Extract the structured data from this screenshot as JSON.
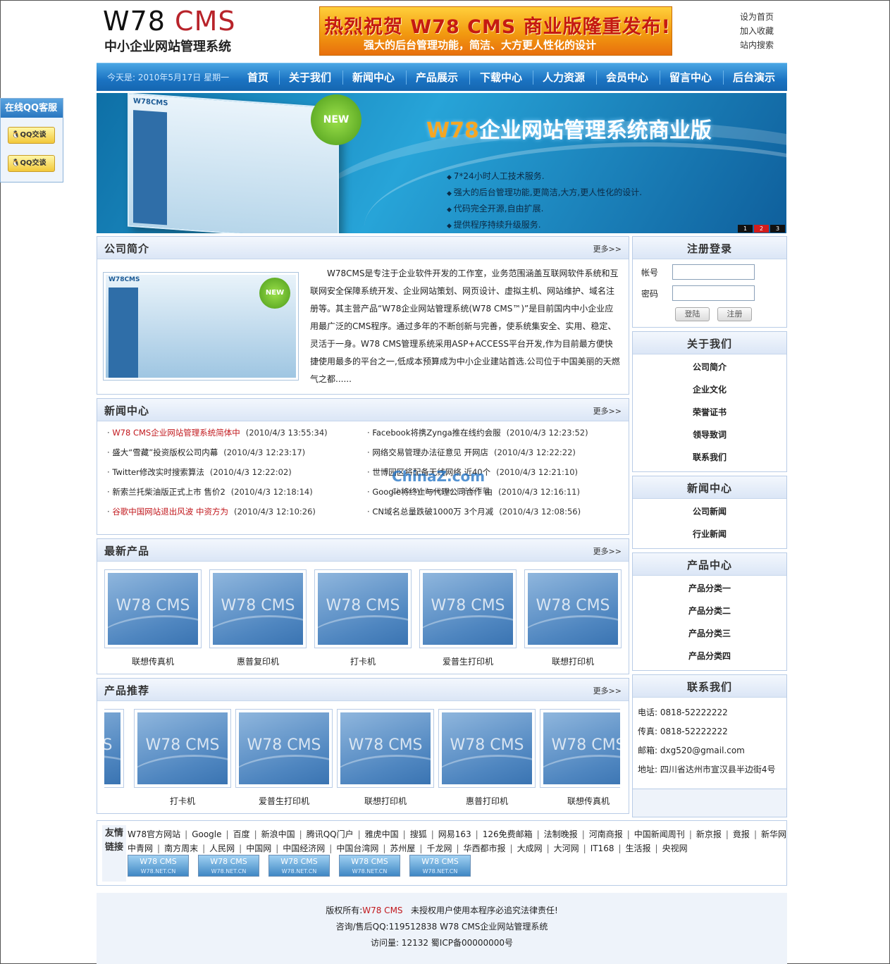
{
  "header": {
    "logo_w78": "W78",
    "logo_cms": "CMS",
    "subtitle": "中小企业网站管理系统",
    "banner_line1": "热烈祝贺 W78 CMS 商业版隆重发布!",
    "banner_line2": "强大的后台管理功能，简洁、大方更人性化的设计",
    "links": [
      "设为首页",
      "加入收藏",
      "站内搜索"
    ]
  },
  "nav": {
    "date": "今天是: 2010年5月17日 星期一",
    "items": [
      "首页",
      "关于我们",
      "新闻中心",
      "产品展示",
      "下载中心",
      "人力资源",
      "会员中心",
      "留言中心",
      "后台演示"
    ]
  },
  "hero": {
    "title_w78": "W78",
    "title_rest": "企业网站管理系统商业版",
    "new_badge": "NEW",
    "bullets": [
      "7*24小时人工技术服务.",
      "强大的后台管理功能,更简洁,大方,更人性化的设计.",
      "代码完全开源,自由扩展.",
      "提供程序持续升级服务."
    ],
    "pager": [
      "1",
      "2",
      "3"
    ],
    "screen_logo": "W78CMS"
  },
  "qq": {
    "title": "在线QQ客服",
    "buttons": [
      "QQ交谈",
      "QQ交谈"
    ]
  },
  "intro": {
    "title": "公司简介",
    "more": "更多>>",
    "img_logo": "W78CMS",
    "img_new": "NEW",
    "text": "W78CMS是专注于企业软件开发的工作室，业务范围涵盖互联网软件系统和互联网安全保障系统开发、企业网站策划、网页设计、虚拟主机、网站维护、域名注册等。其主营产品“W78企业网站管理系统(W78 CMS™)”是目前国内中小企业应用最广泛的CMS程序。通过多年的不断创新与完善，使系统集安全、实用、稳定、灵活于一身。W78 CMS管理系统采用ASP+ACCESS平台开发,作为目前最方便快捷使用最多的平台之一,低成本预算成为中小企业建站首选.公司位于中国美丽的天燃气之都......"
  },
  "news": {
    "title": "新闻中心",
    "more": "更多>>",
    "left": [
      {
        "text": "W78 CMS企业网站管理系统简体中",
        "date": "(2010/4/3 13:55:34)",
        "red": true
      },
      {
        "text": "盛大“雪藏”投资版权公司内幕",
        "date": "(2010/4/3 12:23:17)",
        "red": false
      },
      {
        "text": "Twitter修改实时搜索算法",
        "date": "(2010/4/3 12:22:02)",
        "red": false
      },
      {
        "text": "新索兰托柴油版正式上市 售价2",
        "date": "(2010/4/3 12:18:14)",
        "red": false
      },
      {
        "text": "谷歌中国网站退出风波 中资方为",
        "date": "(2010/4/3 12:10:26)",
        "red": true
      }
    ],
    "right": [
      {
        "text": "Facebook将携Zynga推在线约会服",
        "date": "(2010/4/3 12:23:52)"
      },
      {
        "text": "网络交易管理办法征意见 开网店",
        "date": "(2010/4/3 12:22:22)"
      },
      {
        "text": "世博园区将配备无线网络 近40个",
        "date": "(2010/4/3 12:21:10)"
      },
      {
        "text": "Google将终止与代理公司合作 由",
        "date": "(2010/4/3 12:16:11)"
      },
      {
        "text": "CN域名总量跌破1000万 3个月减",
        "date": "(2010/4/3 12:08:56)"
      }
    ],
    "watermark": "ChinaZ.com",
    "watermark_sub": "China Webmaster | 站长下载"
  },
  "latest_products": {
    "title": "最新产品",
    "more": "更多>>",
    "thumb_text": "W78 CMS",
    "items": [
      "联想传真机",
      "惠普复印机",
      "打卡机",
      "爱普生打印机",
      "联想打印机"
    ]
  },
  "recommended_products": {
    "title": "产品推荐",
    "more": "更多>>",
    "thumb_text": "W78 CMS",
    "items": [
      "打卡机",
      "爱普生打印机",
      "联想打印机",
      "惠普打印机",
      "联想传真机"
    ]
  },
  "login": {
    "title": "注册登录",
    "account_label": "帐号",
    "password_label": "密码",
    "login_btn": "登陆",
    "register_btn": "注册"
  },
  "about": {
    "title": "关于我们",
    "items": [
      "公司简介",
      "企业文化",
      "荣誉证书",
      "领导致词",
      "联系我们"
    ]
  },
  "news_side": {
    "title": "新闻中心",
    "items": [
      "公司新闻",
      "行业新闻"
    ]
  },
  "product_side": {
    "title": "产品中心",
    "items": [
      "产品分类一",
      "产品分类二",
      "产品分类三",
      "产品分类四"
    ]
  },
  "contact": {
    "title": "联系我们",
    "phone": "电话: 0818-52222222",
    "fax": "传真: 0818-52222222",
    "email": "邮箱: dxg520@gmail.com",
    "address": "地址: 四川省达州市宣汉县半边街4号"
  },
  "friend_links": {
    "label": "友情链接",
    "row1": [
      "W78官方网站",
      "Google",
      "百度",
      "新浪中国",
      "腾讯QQ门户",
      "雅虎中国",
      "搜狐",
      "网易163",
      "126免费邮箱",
      "法制晚报",
      "河南商报",
      "中国新闻周刊",
      "新京报",
      "竟报",
      "新华网"
    ],
    "row2": [
      "中青网",
      "南方周末",
      "人民网",
      "中国网",
      "中国经济网",
      "中国台湾网",
      "苏州屋",
      "千龙网",
      "华西都市报",
      "大成网",
      "大河网",
      "IT168",
      "生活报",
      "央视网"
    ],
    "badge_text": "W78 CMS",
    "badge_sub": "W78.NET.CN",
    "badge_count": 5
  },
  "footer": {
    "copyright_prefix": "版权所有:",
    "copyright_name": "W78 CMS",
    "copyright_suffix": "未授权用户使用本程序必追究法律责任!",
    "consult": "咨询/售后QQ:119512838 W78 CMS企业网站管理系统",
    "visits": "访问量: 12132   蜀ICP备00000000号"
  }
}
